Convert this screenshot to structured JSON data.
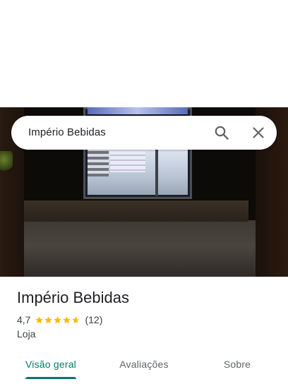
{
  "search": {
    "query": "Império Bebidas",
    "search_icon": "search-icon",
    "close_icon": "close-icon"
  },
  "place": {
    "title": "Império Bebidas",
    "rating": "4,7",
    "rating_value": 4.7,
    "stars_max": 5,
    "review_count": "(12)",
    "category": "Loja"
  },
  "tabs": [
    {
      "label": "Visão geral",
      "active": true
    },
    {
      "label": "Avaliações",
      "active": false
    },
    {
      "label": "Sobre",
      "active": false
    }
  ],
  "colors": {
    "accent": "#00796b",
    "star": "#fbbc04",
    "text_primary": "#202124",
    "text_secondary": "#3c4043"
  }
}
